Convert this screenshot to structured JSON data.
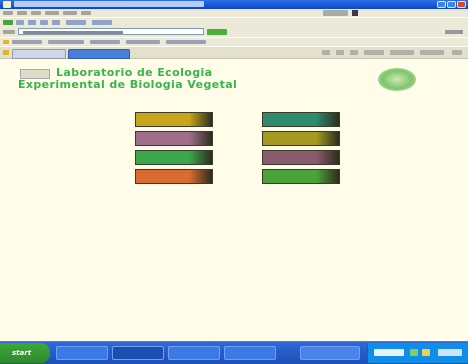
{
  "browser": {
    "title": "",
    "address": "",
    "menus": [
      "",
      "",
      "",
      "",
      "",
      ""
    ],
    "tabs": [
      "",
      ""
    ]
  },
  "page": {
    "nav_button": "",
    "title_line1": "Laboratorio de Ecologia",
    "title_line2": "Experimental de Biologia Vegetal",
    "logo_text": ""
  },
  "tiles": [
    {
      "label": "",
      "color": "#c9a51b"
    },
    {
      "label": "",
      "color": "#9f6e8a"
    },
    {
      "label": "",
      "color": "#3aa84a"
    },
    {
      "label": "",
      "color": "#d96a32"
    },
    {
      "label": "",
      "color": "#2f8a6e"
    },
    {
      "label": "",
      "color": "#a39a22"
    },
    {
      "label": "",
      "color": "#8a5a6e"
    },
    {
      "label": "",
      "color": "#4aa23a"
    }
  ],
  "taskbar": {
    "start_label": "start",
    "tasks": [
      "",
      "",
      "",
      "",
      ""
    ],
    "clock": ""
  },
  "colors": {
    "accent_green": "#3ab34a",
    "page_background": "#fffde9",
    "titlebar_blue": "#0a47c9",
    "taskbar_blue": "#1d4fb8"
  }
}
